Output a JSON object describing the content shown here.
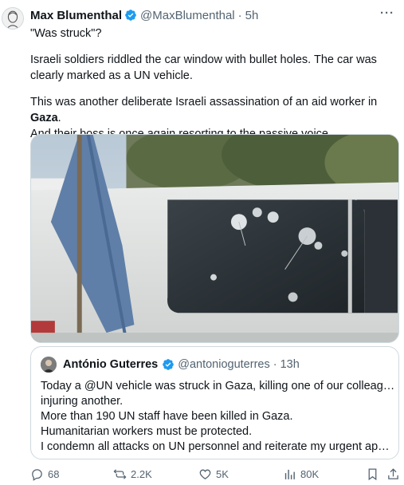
{
  "post": {
    "author_name": "Max Blumenthal",
    "author_handle": "@MaxBlumenthal",
    "separator": "·",
    "time": "5h",
    "more_label": "···",
    "line1": "\"Was struck\"?",
    "para2": "Israeli soldiers riddled the car window with bullet holes. The car was clearly marked as a UN vehicle.",
    "para3_before": "This was another deliberate Israeli assassination of an aid worker in ",
    "para3_highlight": "Gaza",
    "para3_after": ".",
    "para3_line2": "And their boss is once again resorting to the passive voice."
  },
  "quote": {
    "author_name": "António Guterres",
    "author_handle": "@antonioguterres",
    "separator": "·",
    "time": "13h",
    "lines": [
      "Today a @UN vehicle was struck in Gaza, killing one of our colleagues &",
      "injuring another.",
      "More than 190 UN staff have been killed in Gaza.",
      "Humanitarian workers must be protected.",
      "I condemn all attacks on UN personnel and reiterate my urgent appeal..."
    ]
  },
  "actions": {
    "replies": "68",
    "reposts": "2.2K",
    "likes": "5K",
    "views": "80K"
  },
  "colors": {
    "verified": "#1d9bf0",
    "secondary_text": "#536471",
    "border": "#cfd9de"
  },
  "icons": [
    "verified-badge-icon",
    "reply-icon",
    "repost-icon",
    "like-icon",
    "views-icon",
    "bookmark-icon",
    "share-icon"
  ]
}
